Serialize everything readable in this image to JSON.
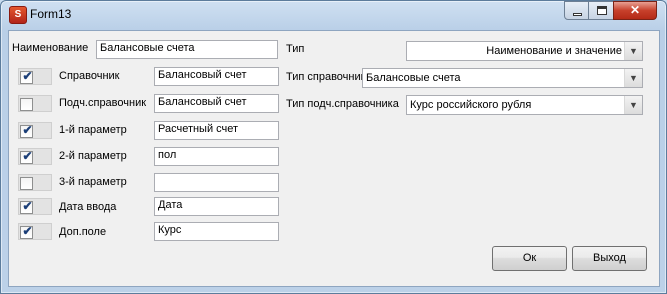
{
  "window": {
    "title": "Form13",
    "app_icon_glyph": "S",
    "controls": {
      "minimize": "minimize-icon",
      "maximize": "maximize-icon",
      "close": "close-icon",
      "close_glyph": "✕"
    }
  },
  "fields": {
    "name_label": "Наименование",
    "name_value": "Балансовые счета",
    "rows": [
      {
        "label": "Справочник",
        "checked": true,
        "value": "Балансовый счет"
      },
      {
        "label": "Подч.справочник",
        "checked": false,
        "value": "Балансовый счет"
      },
      {
        "label": "1-й параметр",
        "checked": true,
        "value": "Расчетный счет"
      },
      {
        "label": "2-й параметр",
        "checked": true,
        "value": "пол"
      },
      {
        "label": "3-й параметр",
        "checked": false,
        "value": ""
      },
      {
        "label": "Дата ввода",
        "checked": true,
        "value": "Дата"
      },
      {
        "label": "Доп.поле",
        "checked": true,
        "value": "Курс"
      }
    ],
    "type_label": "Тип",
    "type_value": "Наименование и значение",
    "dir_type_label": "Тип справочника",
    "dir_type_value": "Балансовые счета",
    "subdir_type_label": "Тип подч.справочника",
    "subdir_type_value": "Курс российского рубля"
  },
  "buttons": {
    "ok": "Ок",
    "exit": "Выход"
  },
  "checkmark_glyph": "✔",
  "dropdown_glyph": "▼"
}
